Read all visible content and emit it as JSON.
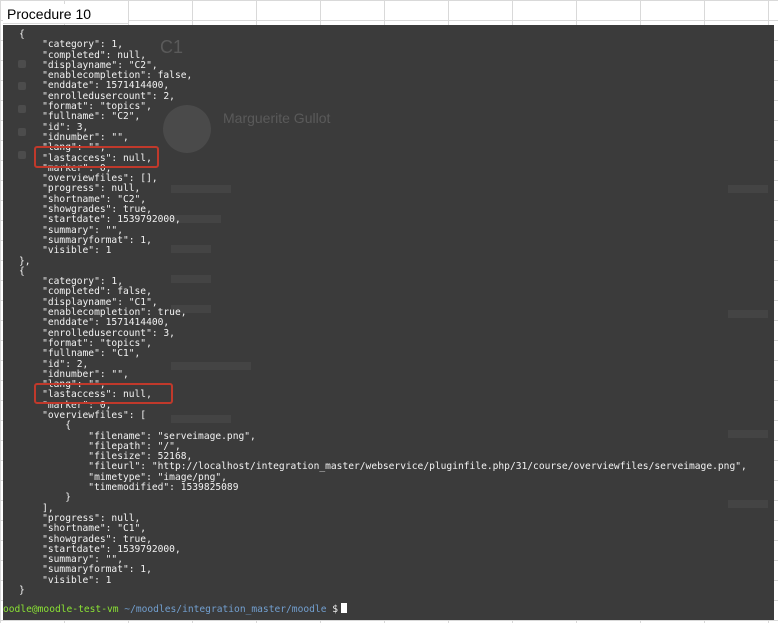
{
  "sheet": {
    "cell_a1": "Procedure 10"
  },
  "terminal": {
    "json_lines": [
      "{",
      "    \"category\": 1,",
      "    \"completed\": null,",
      "    \"displayname\": \"C2\",",
      "    \"enablecompletion\": false,",
      "    \"enddate\": 1571414400,",
      "    \"enrolledusercount\": 2,",
      "    \"format\": \"topics\",",
      "    \"fullname\": \"C2\",",
      "    \"id\": 3,",
      "    \"idnumber\": \"\",",
      "    \"lang\": \"\",",
      "    \"lastaccess\": null,",
      "    \"marker\": 0,",
      "    \"overviewfiles\": [],",
      "    \"progress\": null,",
      "    \"shortname\": \"C2\",",
      "    \"showgrades\": true,",
      "    \"startdate\": 1539792000,",
      "    \"summary\": \"\",",
      "    \"summaryformat\": 1,",
      "    \"visible\": 1",
      "},",
      "{",
      "    \"category\": 1,",
      "    \"completed\": false,",
      "    \"displayname\": \"C1\",",
      "    \"enablecompletion\": true,",
      "    \"enddate\": 1571414400,",
      "    \"enrolledusercount\": 3,",
      "    \"format\": \"topics\",",
      "    \"fullname\": \"C1\",",
      "    \"id\": 2,",
      "    \"idnumber\": \"\",",
      "    \"lang\": \"\",",
      "    \"lastaccess\": null,",
      "    \"marker\": 0,",
      "    \"overviewfiles\": [",
      "        {",
      "            \"filename\": \"serveimage.png\",",
      "            \"filepath\": \"/\",",
      "            \"filesize\": 52168,",
      "            \"fileurl\": \"http://localhost/integration_master/webservice/pluginfile.php/31/course/overviewfiles/serveimage.png\",",
      "            \"mimetype\": \"image/png\",",
      "            \"timemodified\": 1539825089",
      "        }",
      "    ],",
      "    \"progress\": null,",
      "    \"shortname\": \"C1\",",
      "    \"showgrades\": true,",
      "    \"startdate\": 1539792000,",
      "    \"summary\": \"\",",
      "    \"summaryformat\": 1,",
      "    \"visible\": 1",
      "}"
    ],
    "prompt_user": "oodle@moodle-test-vm",
    "prompt_path": " ~/moodles/integration_master/moodle",
    "prompt_symbol": " $",
    "highlight_color": "#c0392b"
  },
  "background_page": {
    "course_title": "C1",
    "user_name": "Marguerite Gullot"
  }
}
